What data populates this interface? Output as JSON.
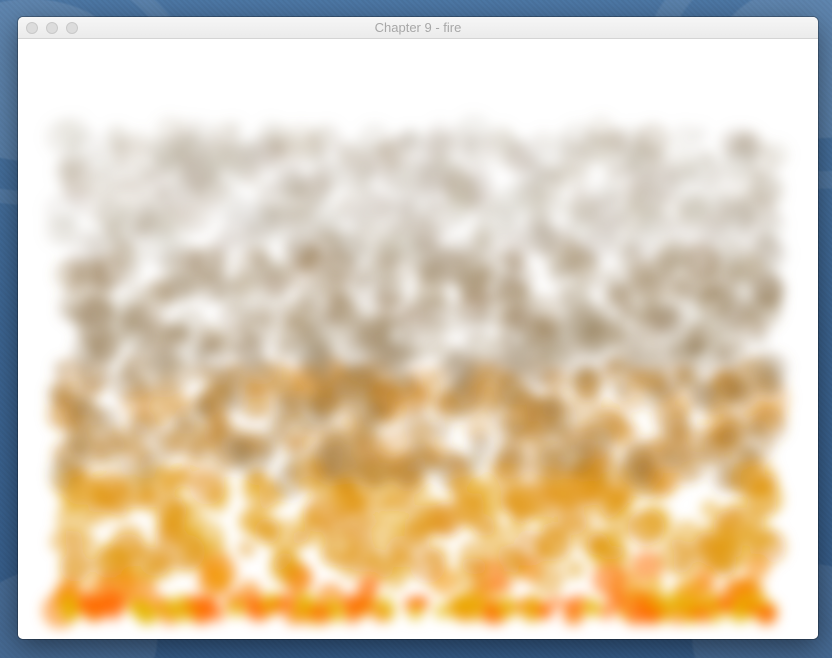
{
  "desktop": {
    "wallpaper_color": "#3f6a98"
  },
  "window": {
    "title": "Chapter 9 - fire",
    "controls": {
      "close_icon": "close-icon",
      "minimize_icon": "minimize-icon",
      "maximize_icon": "maximize-icon"
    }
  },
  "scene": {
    "effect": "particle fire",
    "background": "#ffffff",
    "colors": {
      "flame_core": "#ff6a00",
      "flame_mid": "#e08a10",
      "flame_yellow": "#e6b800",
      "smoke_brown": "#8a6a3a",
      "smoke_gray": "#b4aca0"
    }
  }
}
